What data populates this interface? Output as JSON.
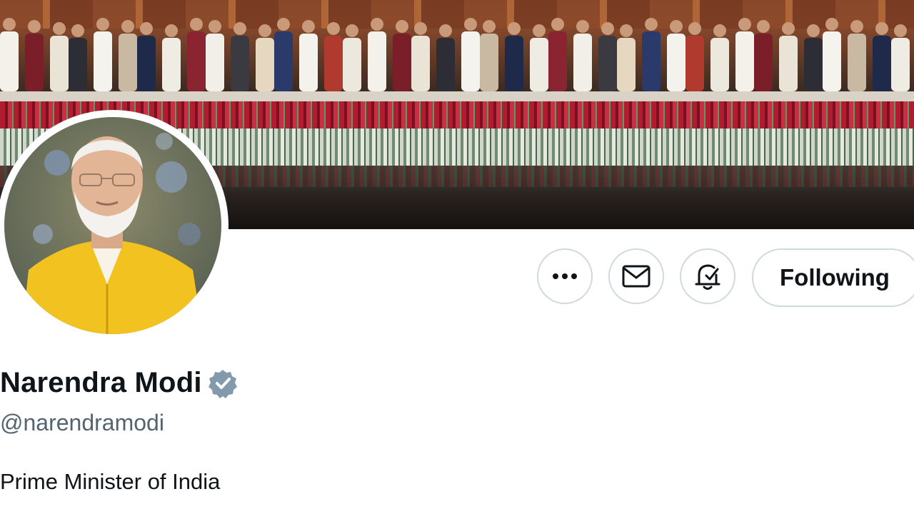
{
  "header": {
    "banner_icon": "cabinet-group-photo",
    "avatar_icon": "profile-portrait"
  },
  "actions": {
    "more_icon": "ellipsis-icon",
    "message_icon": "envelope-icon",
    "notify_icon": "bell-check-icon",
    "following_label": "Following"
  },
  "profile": {
    "display_name": "Narendra Modi",
    "verified_icon": "verified-badge-icon",
    "verified_color": "#829aab",
    "handle": "@narendramodi",
    "bio": "Prime Minister of India"
  },
  "colors": {
    "text_primary": "#0f1419",
    "text_secondary": "#536471",
    "border": "#cfd9de",
    "vest": "#f2c320"
  }
}
